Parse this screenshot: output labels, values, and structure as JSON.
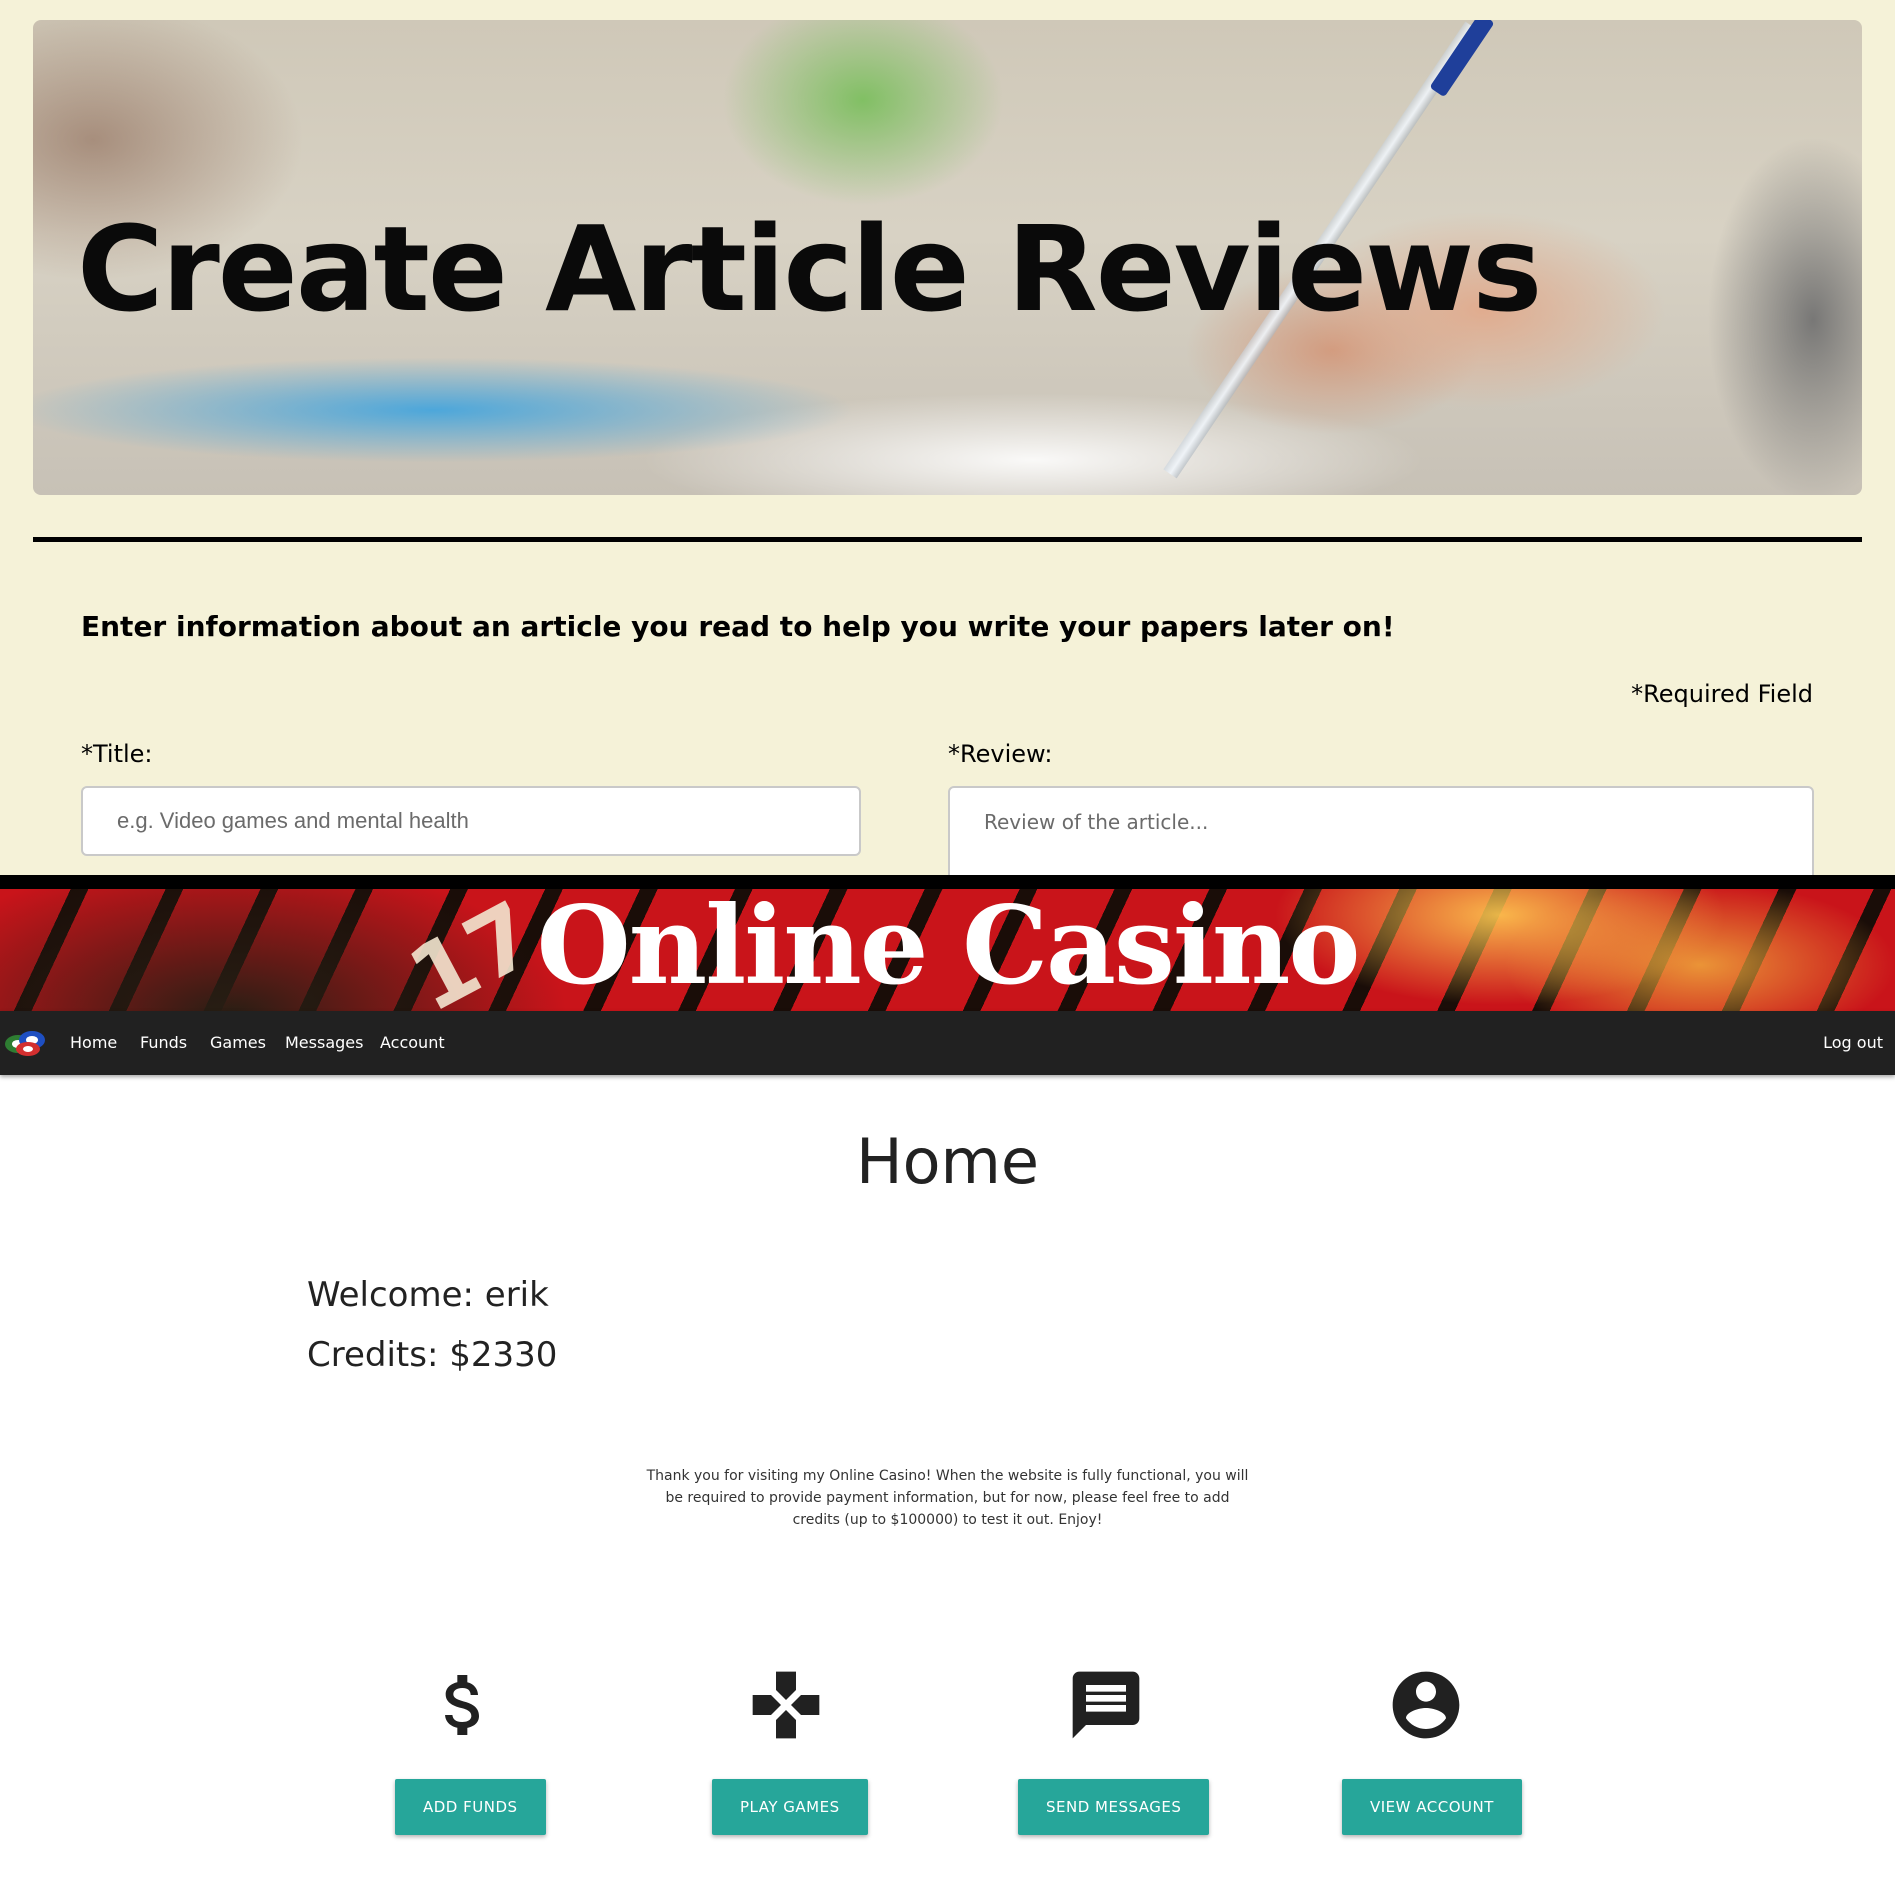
{
  "article_reviews": {
    "hero_title": "Create Article Reviews",
    "intro": "Enter information about an article you read to help you write your papers later on!",
    "required_note": "*Required Field",
    "title_label": "*Title:",
    "title_placeholder": "e.g. Video games and mental health",
    "review_label": "*Review:",
    "review_placeholder": "Review of the article..."
  },
  "casino": {
    "banner_title": "Online Casino",
    "banner_number": "17",
    "nav": {
      "home": "Home",
      "funds": "Funds",
      "games": "Games",
      "messages": "Messages",
      "account": "Account",
      "logout": "Log out"
    },
    "page_title": "Home",
    "welcome": "Welcome: erik",
    "credits": "Credits: $2330",
    "thanks": "Thank you for visiting my Online Casino! When the website is fully functional, you will be required to provide payment information, but for now, please feel free to add credits (up to $100000) to test it out. Enjoy!",
    "actions": [
      {
        "icon": "dollar-icon",
        "label": "ADD FUNDS"
      },
      {
        "icon": "gamepad-icon",
        "label": "PLAY GAMES"
      },
      {
        "icon": "message-icon",
        "label": "SEND MESSAGES"
      },
      {
        "icon": "account-circle-icon",
        "label": "VIEW ACCOUNT"
      }
    ],
    "colors": {
      "accent": "#26a69a",
      "navbar": "#212121",
      "form_background": "#f5f2d8"
    }
  }
}
